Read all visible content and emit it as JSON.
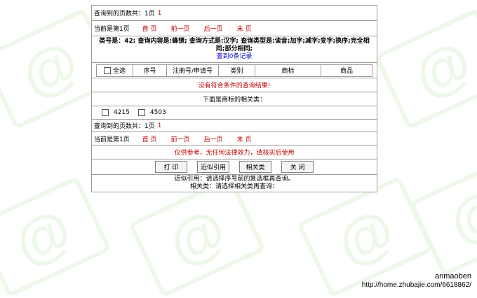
{
  "summary_top": {
    "label": "查询到的页数共：1页",
    "count": "1"
  },
  "pager": {
    "current": "当前是第1页",
    "first": "首 页",
    "prev": "前一页",
    "next": "后一页",
    "last": "末 页"
  },
  "query_info": {
    "text": "类号是：42; 查询内容是:蜂镜; 查询方式是:汉字; 查询类型是:读音;加字;减字;变字;换序;完全相同;部分相同;",
    "result_link": "查到0条记录"
  },
  "table_header": {
    "select_all": "全选",
    "columns": [
      "序号",
      "注册号/申请号",
      "类别",
      "商标",
      "商品"
    ]
  },
  "no_result": "没有符合条件的查询结果!",
  "related_heading": "下面是商标的相关类：",
  "related_classes": [
    "4215",
    "4503"
  ],
  "summary_bottom": {
    "label": "查询到的页数共：1页",
    "count": "1"
  },
  "disclaimer": "仅供参考，无任何法律效力，请核实后使用",
  "actions": {
    "print": "打 印",
    "similar": "近似引用",
    "related": "相关类",
    "close": "关 闭"
  },
  "notes": [
    "近似引用：请选择序号前的复选框再查询。",
    "相关类：请选择相关类再查询："
  ],
  "watermark": {
    "user": "anmaoben",
    "url": "http://home.zhubajie.com/6618862/"
  },
  "colors": {
    "link": "#c00000",
    "accent": "#0000cc",
    "border": "#9a9a9a"
  }
}
